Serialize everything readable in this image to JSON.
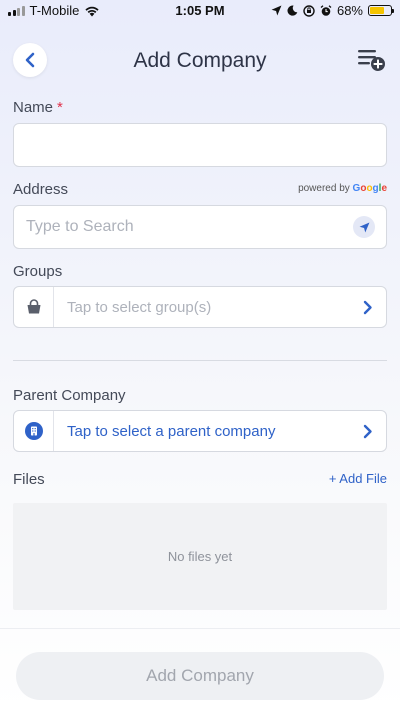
{
  "status_bar": {
    "carrier": "T-Mobile",
    "time": "1:05 PM",
    "battery": "68%",
    "battery_level": 0.68,
    "icons": [
      "signal-icon",
      "wifi-icon",
      "location-arrow-icon",
      "moon-icon",
      "screen-lock-icon",
      "alarm-icon",
      "battery-icon"
    ]
  },
  "nav": {
    "title": "Add Company",
    "back_icon": "chevron-left-icon",
    "menu_icon": "list-add-icon"
  },
  "form": {
    "name": {
      "label": "Name",
      "required_mark": "*",
      "value": ""
    },
    "address": {
      "label": "Address",
      "placeholder": "Type to Search",
      "powered_by": "powered by",
      "google": [
        "G",
        "o",
        "o",
        "g",
        "l",
        "e"
      ]
    },
    "groups": {
      "label": "Groups",
      "placeholder": "Tap to select group(s)",
      "icon": "basket-icon"
    },
    "parent_company": {
      "label": "Parent Company",
      "placeholder": "Tap to select a parent company",
      "icon": "building-icon"
    },
    "files": {
      "label": "Files",
      "add_label": "+ Add File",
      "empty_text": "No files yet"
    }
  },
  "submit": {
    "label": "Add Company"
  },
  "colors": {
    "accent": "#2f62c8",
    "required": "#e0304a",
    "battery": "#f5c400"
  }
}
